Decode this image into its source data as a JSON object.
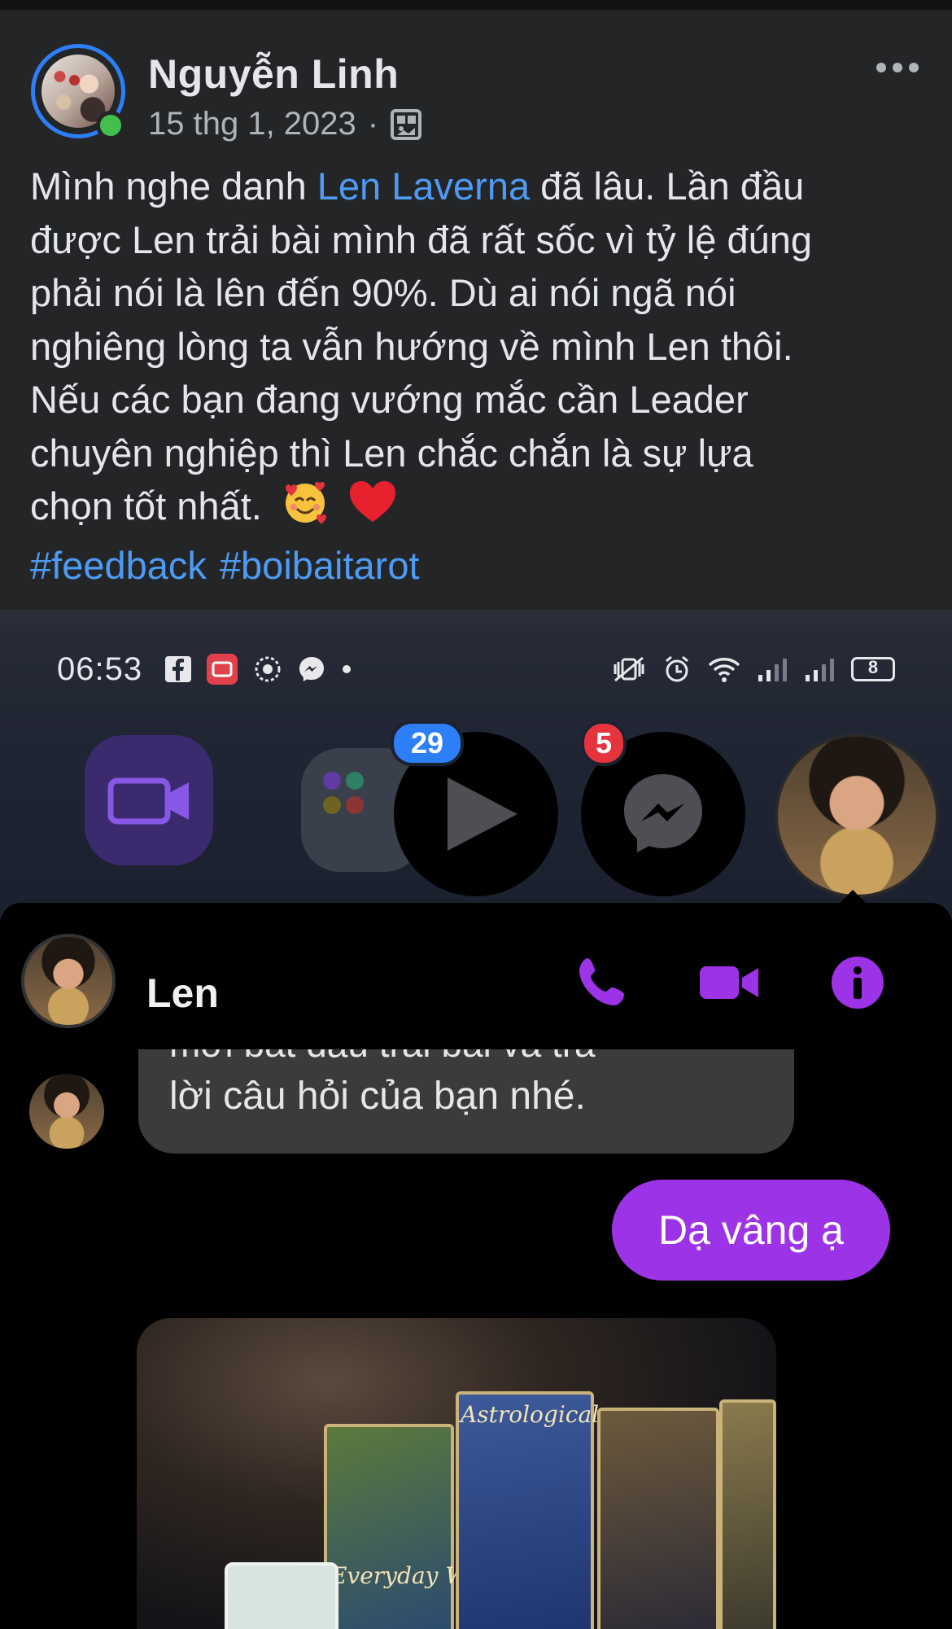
{
  "post": {
    "author": "Nguyễn Linh",
    "date": "15 thg 1, 2023",
    "separator": "·",
    "audience_icon": "photo-gallery-icon",
    "more_icon": "more-dots-icon",
    "text_lines": [
      [
        "Mình nghe danh ",
        "Len Laverna",
        " đã lâu. Lần đầu"
      ],
      "được Len trải bài mình đã rất sốc vì tỷ lệ đúng",
      "phải nói là lên đến 90%. Dù ai nói ngã nói",
      "nghiêng lòng ta vẫn hướng về mình Len thôi.",
      "Nếu các bạn đang vướng mắc cần Leader",
      "chuyên nghiệp thì Len chắc chắn là sự lựa",
      "chọn tốt nhất."
    ],
    "mention": "Len Laverna",
    "emojis": [
      "smiling-face-with-hearts-icon",
      "red-heart-icon"
    ],
    "hashtags": [
      "#feedback",
      "#boibaitarot"
    ],
    "colors": {
      "link": "#4d9bf4",
      "online": "#44be4f",
      "ring": "#2d7ff9",
      "background": "#242526"
    }
  },
  "screenshot": {
    "status_time": "06:53",
    "battery": "8",
    "status_icons": [
      "facebook-icon",
      "youtube-icon",
      "app-icon",
      "messenger-icon",
      "dot-icon"
    ],
    "status_right_icons": [
      "mute-vibrate-icon",
      "alarm-icon",
      "wifi-icon",
      "signal-icon",
      "signal-icon",
      "battery-icon"
    ],
    "badges": {
      "video": "29",
      "messenger": "5"
    },
    "chat": {
      "contact_name": "Len",
      "header_icons": [
        "phone-icon",
        "video-call-icon",
        "info-icon"
      ],
      "incoming_cut_text": "mới bắt đầu trải bài và trả",
      "incoming_text": "lời câu hỏi của bạn nhé.",
      "outgoing_text": "Dạ vâng ạ",
      "card_labels": [
        "Astrological",
        "Everyday Witch"
      ],
      "accent": "#9d33e6"
    }
  }
}
